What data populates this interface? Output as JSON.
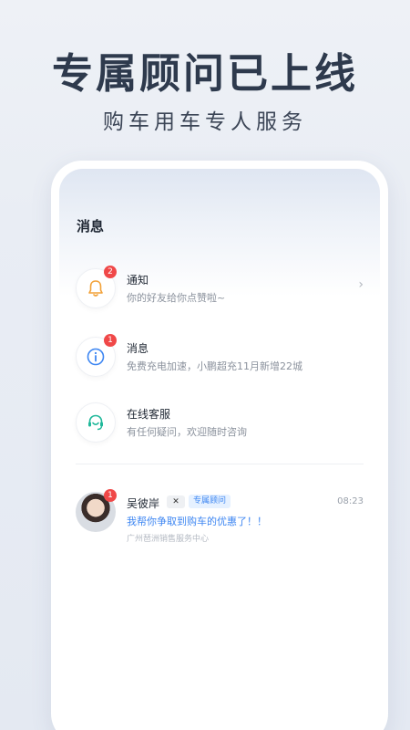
{
  "hero": {
    "title": "专属顾问已上线",
    "subtitle": "购车用车专人服务"
  },
  "screen": {
    "title": "消息",
    "items": [
      {
        "title": "通知",
        "desc": "你的好友给你点赞啦~",
        "badge": "2",
        "icon": "bell-icon",
        "color": "#f2a23a",
        "has_chevron": true
      },
      {
        "title": "消息",
        "desc": "免费充电加速，小鹏超充11月新增22城",
        "badge": "1",
        "icon": "info-icon",
        "color": "#3d86f2",
        "has_chevron": false
      },
      {
        "title": "在线客服",
        "desc": "有任何疑问，欢迎随时咨询",
        "badge": "",
        "icon": "headset-icon",
        "color": "#1fb89a",
        "has_chevron": false
      }
    ],
    "chevron": "›",
    "chat": {
      "name": "吴彼岸",
      "brand_tag": "✕",
      "role_tag": "专属顾问",
      "time": "08:23",
      "message": "我帮你争取到购车的优惠了！！",
      "org": "广州琶洲销售服务中心",
      "badge": "1"
    }
  },
  "colors": {
    "badge": "#f04848",
    "accent_blue": "#3d86f2"
  }
}
